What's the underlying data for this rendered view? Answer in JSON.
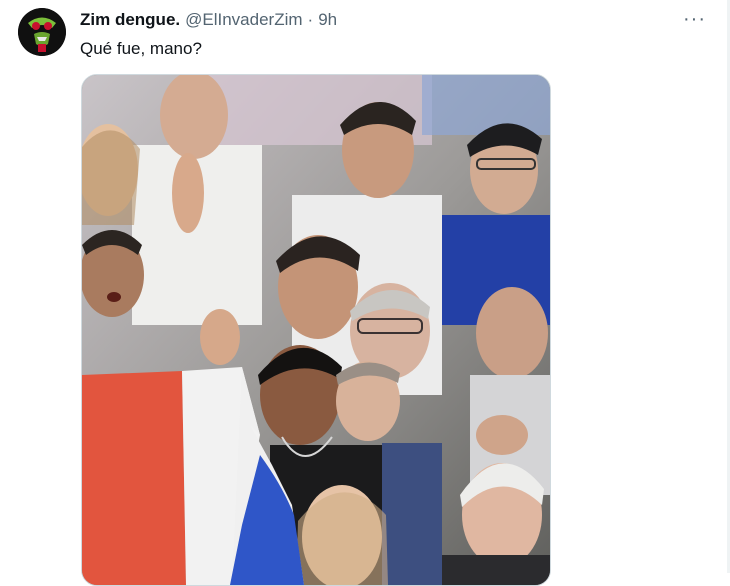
{
  "tweet": {
    "display_name": "Zim dengue.",
    "handle": "@ElInvaderZim",
    "separator": "·",
    "time": "9h",
    "text": "Qué fue, mano?",
    "avatar_icon": "zim-avatar-icon",
    "more_icon": "more-options-icon",
    "more_glyph": "···"
  },
  "media": {
    "kind": "photo",
    "description_icon": "crowd-photo-image"
  },
  "colors": {
    "text_primary": "#0f1419",
    "text_secondary": "#536471",
    "border": "#cfd9de",
    "flag_blue": "#2f56c8",
    "flag_white": "#f2f2f2",
    "flag_red": "#e2553e",
    "jersey_blue": "#2340a6"
  }
}
